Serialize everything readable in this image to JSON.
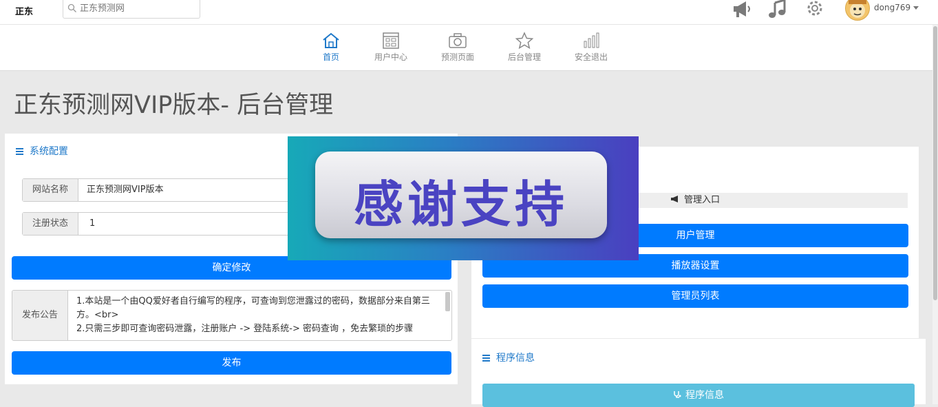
{
  "brand": "正东",
  "search": {
    "placeholder": "正东预测网"
  },
  "top_icons": [
    "megaphone-icon",
    "music-icon",
    "gear-icon"
  ],
  "user": {
    "name": "dong769"
  },
  "nav": [
    {
      "label": "首页",
      "icon": "home-icon",
      "active": true
    },
    {
      "label": "用户中心",
      "icon": "user-center-icon",
      "active": false
    },
    {
      "label": "预测页面",
      "icon": "camera-icon",
      "active": false
    },
    {
      "label": "后台管理",
      "icon": "star-icon",
      "active": false
    },
    {
      "label": "安全退出",
      "icon": "bars-icon",
      "active": false
    }
  ],
  "page_title": "正东预测网VIP版本- 后台管理",
  "config_panel": {
    "title": "系统配置",
    "site_name_label": "网站名称",
    "site_name_value": "正东预测网VIP版本",
    "reg_status_label": "注册状态",
    "reg_status_value": "1",
    "confirm_button": "确定修改",
    "notice_label": "发布公告",
    "notice_text": "1.本站是一个由QQ爱好者自行编写的程序，可查询到您泄露过的密码，数据部分来自第三方。<br>\n2.只需三步即可查询密码泄露，注册账户 -> 登陆系统-> 密码查询 ，免去繁琐的步骤",
    "publish_button": "发布"
  },
  "admin_panel": {
    "entry_label": "管理入口",
    "buttons": [
      "用户管理",
      "播放器设置",
      "管理员列表"
    ]
  },
  "program_panel": {
    "title": "程序信息",
    "button": "程序信息"
  },
  "overlay": {
    "text": "感谢支持"
  },
  "colors": {
    "primary": "#007bff",
    "link": "#1f79c9",
    "info": "#5bc0de"
  }
}
